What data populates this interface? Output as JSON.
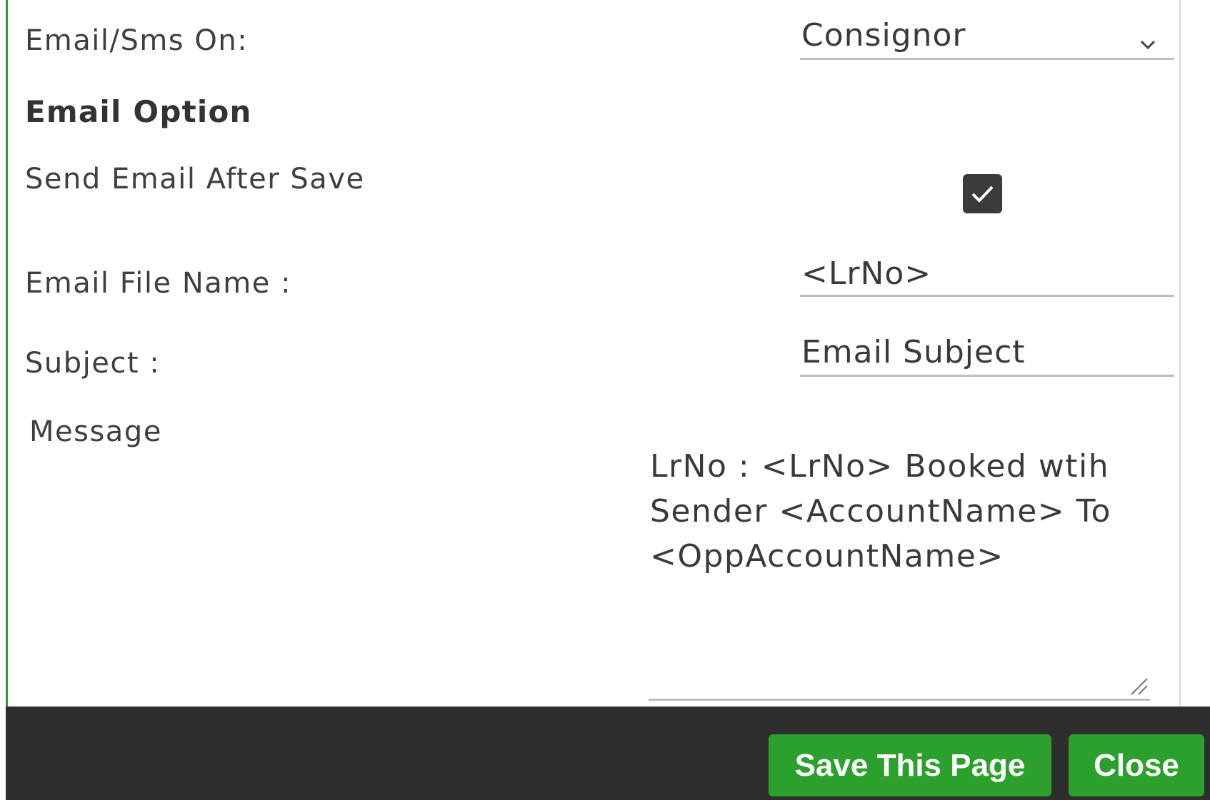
{
  "email_sms_on": {
    "label": "Email/Sms On:",
    "selected": "Consignor"
  },
  "email_option": {
    "title": "Email Option",
    "send_after_save_label": "Send Email After Save",
    "send_after_save_checked": true,
    "file_name_label": "Email File Name :",
    "file_name_value": "<LrNo>",
    "subject_label": "Subject :",
    "subject_value": "Email Subject",
    "message_label": "Message",
    "message_value": "LrNo : <LrNo> Booked wtih Sender <AccountName> To <OppAccountName>"
  },
  "footer": {
    "save_label": "Save This Page",
    "close_label": "Close"
  },
  "colors": {
    "accent_green": "#2ca02c",
    "footer_bg": "#2e2e2e",
    "checkbox_bg": "#3b3b3b"
  }
}
